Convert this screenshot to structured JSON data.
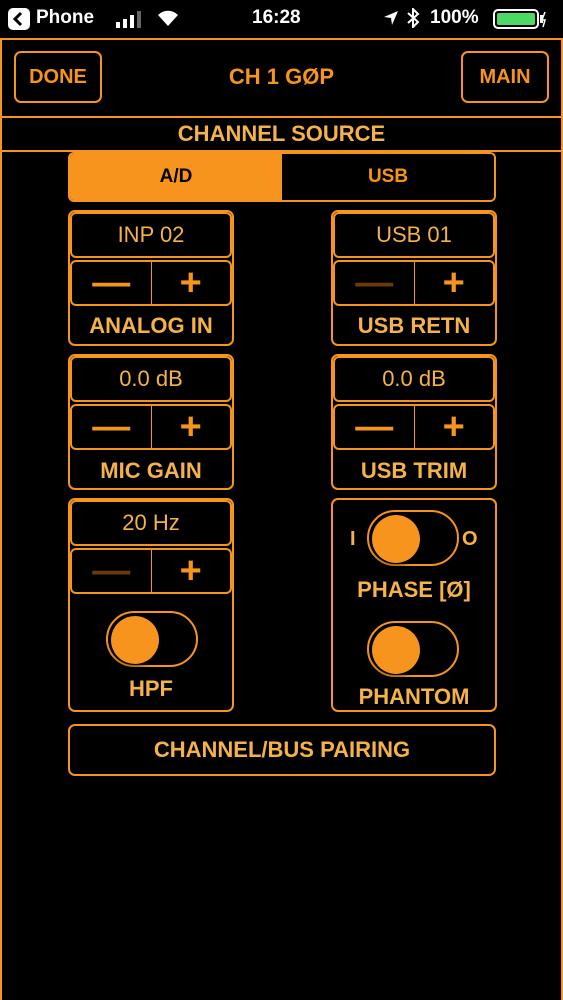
{
  "status": {
    "carrier": "Phone",
    "time": "16:28",
    "battery": "100%"
  },
  "header": {
    "done": "DONE",
    "title": "CH 1 GØP",
    "main": "MAIN"
  },
  "source": {
    "heading": "CHANNEL SOURCE",
    "tab_ad": "A/D",
    "tab_usb": "USB"
  },
  "analog": {
    "value": "INP 02",
    "minus": "—",
    "plus": "+",
    "label": "ANALOG IN"
  },
  "usb_retn": {
    "value": "USB 01",
    "minus": "—",
    "plus": "+",
    "label": "USB RETN"
  },
  "mic_gain": {
    "value": "0.0 dB",
    "minus": "—",
    "plus": "+",
    "label": "MIC GAIN"
  },
  "usb_trim": {
    "value": "0.0 dB",
    "minus": "—",
    "plus": "+",
    "label": "USB TRIM"
  },
  "hpf": {
    "value": "20 Hz",
    "minus": "—",
    "plus": "+",
    "label": "HPF"
  },
  "phase": {
    "on": "I",
    "off": "O",
    "label": "PHASE [Ø]"
  },
  "phantom": {
    "label": "PHANTOM"
  },
  "pairing": {
    "label": "CHANNEL/BUS PAIRING"
  },
  "colors": {
    "accent": "#f7941d",
    "text": "#f5b24a",
    "background": "#000000"
  }
}
